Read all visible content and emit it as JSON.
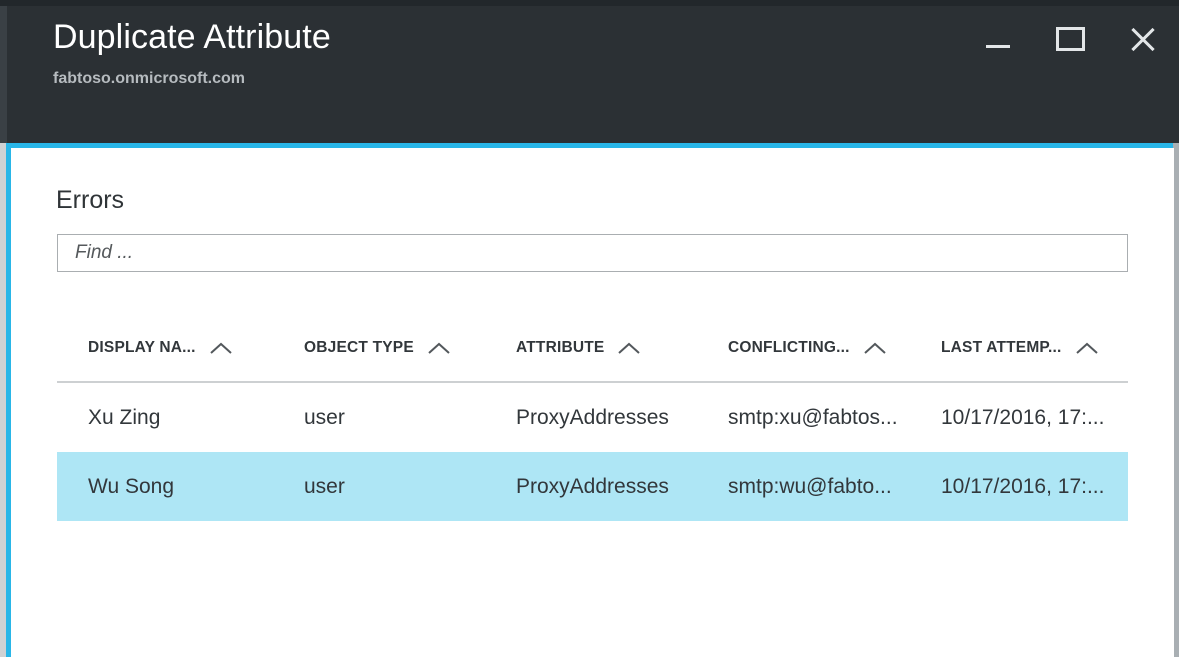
{
  "window": {
    "title": "Duplicate Attribute",
    "subtitle": "fabtoso.onmicrosoft.com",
    "controls": {
      "minimize_label": "Minimize",
      "maximize_label": "Maximize",
      "close_label": "Close"
    },
    "accent_color": "#29b6e8",
    "titlebar_color": "#2b3034"
  },
  "content": {
    "heading": "Errors",
    "search": {
      "placeholder": "Find ...",
      "value": ""
    }
  },
  "table": {
    "columns": [
      {
        "label": "DISPLAY NA...",
        "sort": "ascending"
      },
      {
        "label": "OBJECT TYPE",
        "sort": "ascending"
      },
      {
        "label": "ATTRIBUTE",
        "sort": "ascending"
      },
      {
        "label": "CONFLICTING...",
        "sort": "ascending"
      },
      {
        "label": "LAST ATTEMP...",
        "sort": "ascending"
      }
    ],
    "rows": [
      {
        "display_name": "Xu Zing",
        "object_type": "user",
        "attribute": "ProxyAddresses",
        "conflicting_value": "smtp:xu@fabtos...",
        "last_attempt": "10/17/2016, 17:...",
        "selected": false
      },
      {
        "display_name": "Wu Song",
        "object_type": "user",
        "attribute": "ProxyAddresses",
        "conflicting_value": "smtp:wu@fabto...",
        "last_attempt": "10/17/2016, 17:...",
        "selected": true
      }
    ],
    "selection_color": "#aee6f5"
  }
}
